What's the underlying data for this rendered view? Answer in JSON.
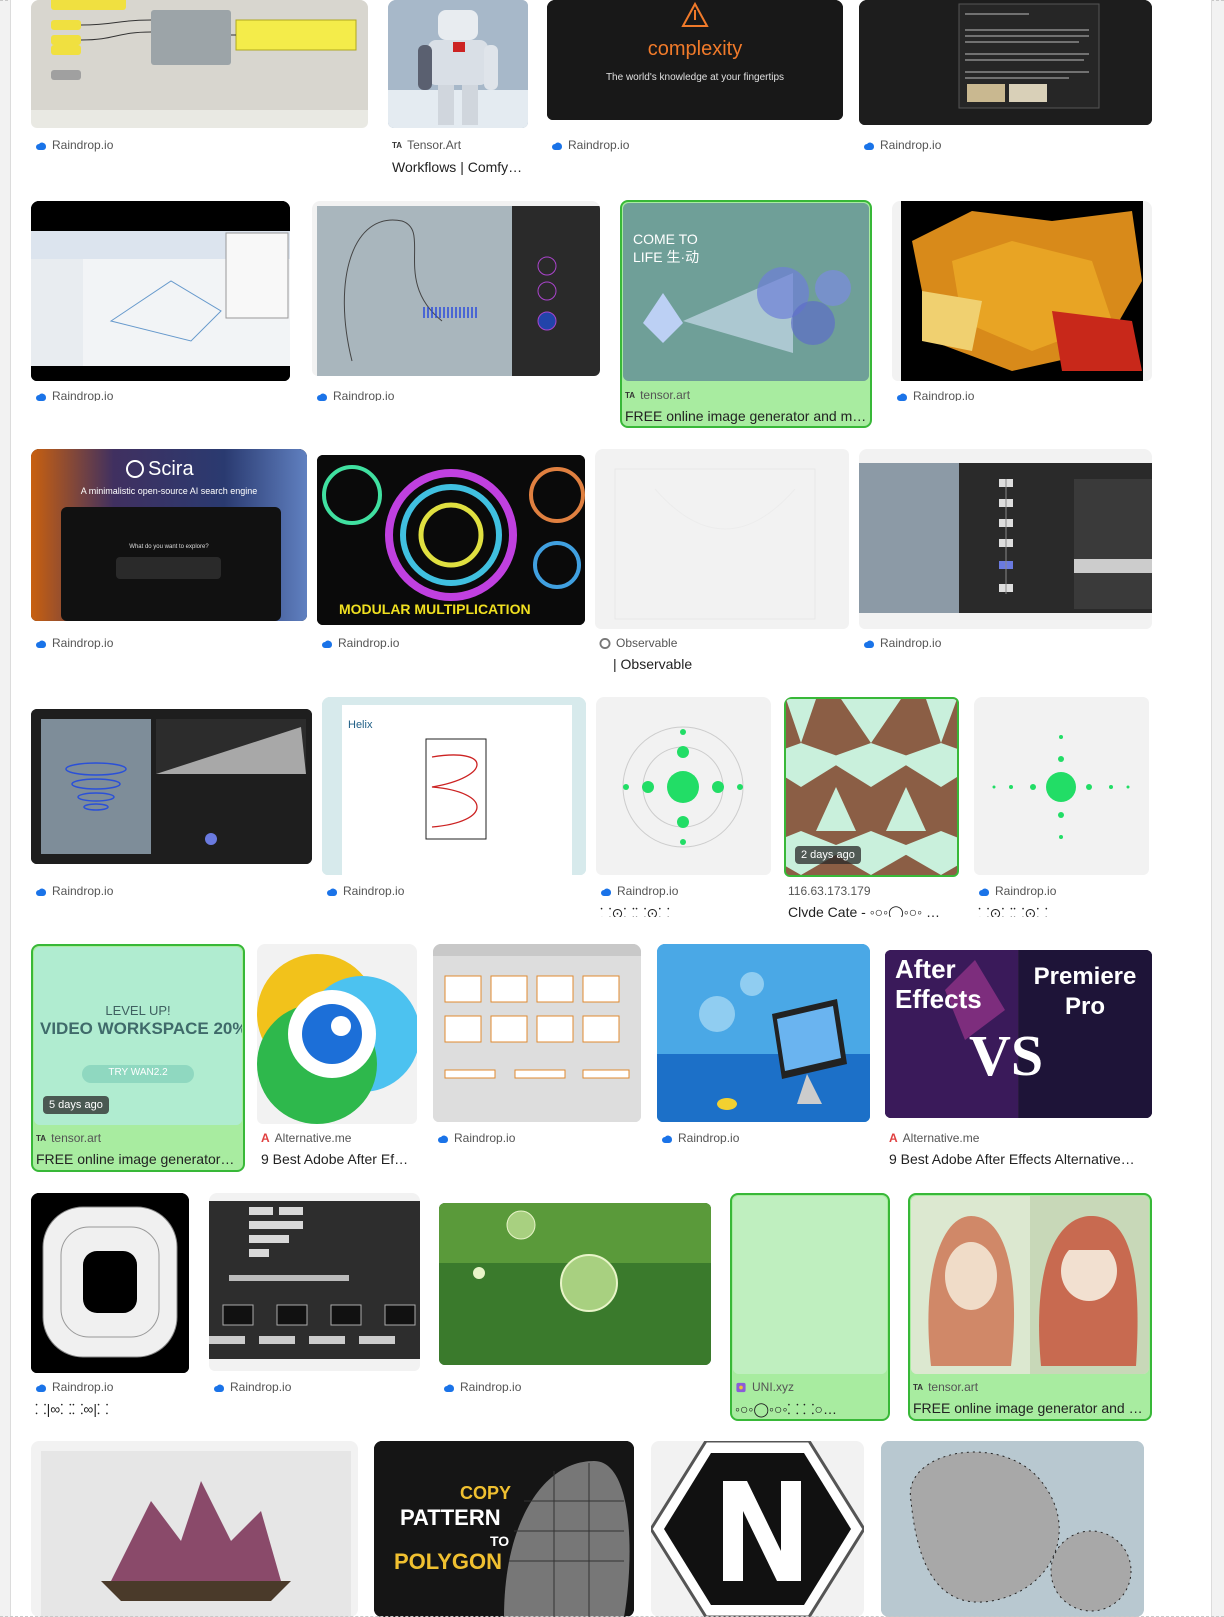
{
  "colors": {
    "highlight_bg": "#a8eca0",
    "highlight_border": "#38b838",
    "raindrop_blue": "#1a73e8",
    "tensor_green": "#3fb34f"
  },
  "items": [
    {
      "source": "Raindrop.io",
      "title": ""
    },
    {
      "source": "Tensor.Art",
      "title": "Workflows | Comfy…"
    },
    {
      "source": "Raindrop.io",
      "title": "",
      "thumb_text": {
        "brand": "complexity",
        "tagline": "The world's knowledge at your fingertips"
      }
    },
    {
      "source": "Raindrop.io",
      "title": ""
    },
    {
      "source": "Raindrop.io",
      "title": ""
    },
    {
      "source": "Raindrop.io",
      "title": ""
    },
    {
      "source": "tensor.art",
      "title": "FREE online image generator and m…",
      "thumb_text": {
        "line1": "COME TO",
        "line2": "LIFE 生·动"
      }
    },
    {
      "source": "Raindrop.io",
      "title": ""
    },
    {
      "source": "Raindrop.io",
      "title": "",
      "thumb_text": {
        "brand": "Scira",
        "tagline": "A minimalistic open-source AI search engine",
        "prompt": "What do you want to explore?"
      }
    },
    {
      "source": "Raindrop.io",
      "title": "",
      "thumb_text": {
        "caption": "MODULAR MULTIPLICATION"
      }
    },
    {
      "source": "Observable",
      "title": "| Observable"
    },
    {
      "source": "Raindrop.io",
      "title": ""
    },
    {
      "source": "Raindrop.io",
      "title": ""
    },
    {
      "source": "Raindrop.io",
      "title": "",
      "thumb_text": {
        "heading": "Helix"
      }
    },
    {
      "source": "Raindrop.io",
      "title": "⸬⊙⸬⸬⊙⸬"
    },
    {
      "source": "116.63.173.179",
      "title": "Clyde Cate - ◦○◦◯◦○◦ …",
      "ago": "2 days ago"
    },
    {
      "source": "Raindrop.io",
      "title": "⸬⊙⸬⸬⊙⸬"
    },
    {
      "source": "tensor.art",
      "title": "FREE online image generator…",
      "ago": "5 days ago",
      "thumb_text": {
        "line1": "LEVEL UP!",
        "line2": "VIDEO WORKSPACE 20% O",
        "button": "TRY WAN2.2"
      }
    },
    {
      "source": "Alternative.me",
      "title": "9 Best Adobe After Ef…"
    },
    {
      "source": "Raindrop.io",
      "title": ""
    },
    {
      "source": "Raindrop.io",
      "title": ""
    },
    {
      "source": "Alternative.me",
      "title": "9 Best Adobe After Effects Alternative…",
      "thumb_text": {
        "left": "After Effects",
        "right": "Premiere Pro",
        "vs": "VS"
      }
    },
    {
      "source": "Raindrop.io",
      "title": "⸬|∞⸬⸬∞|⸬"
    },
    {
      "source": "Raindrop.io",
      "title": ""
    },
    {
      "source": "Raindrop.io",
      "title": ""
    },
    {
      "source": "UNI.xyz",
      "title": "◦○◦◯◦○◦⸬ ⸬○…"
    },
    {
      "source": "tensor.art",
      "title": "FREE online image generator and mo…"
    },
    {
      "source": "",
      "title": ""
    },
    {
      "source": "",
      "title": "",
      "thumb_text": {
        "line1": "COPY",
        "line2": "PATTERN",
        "line3": "TO",
        "line4": "POLYGON"
      }
    },
    {
      "source": "",
      "title": ""
    },
    {
      "source": "",
      "title": ""
    }
  ]
}
